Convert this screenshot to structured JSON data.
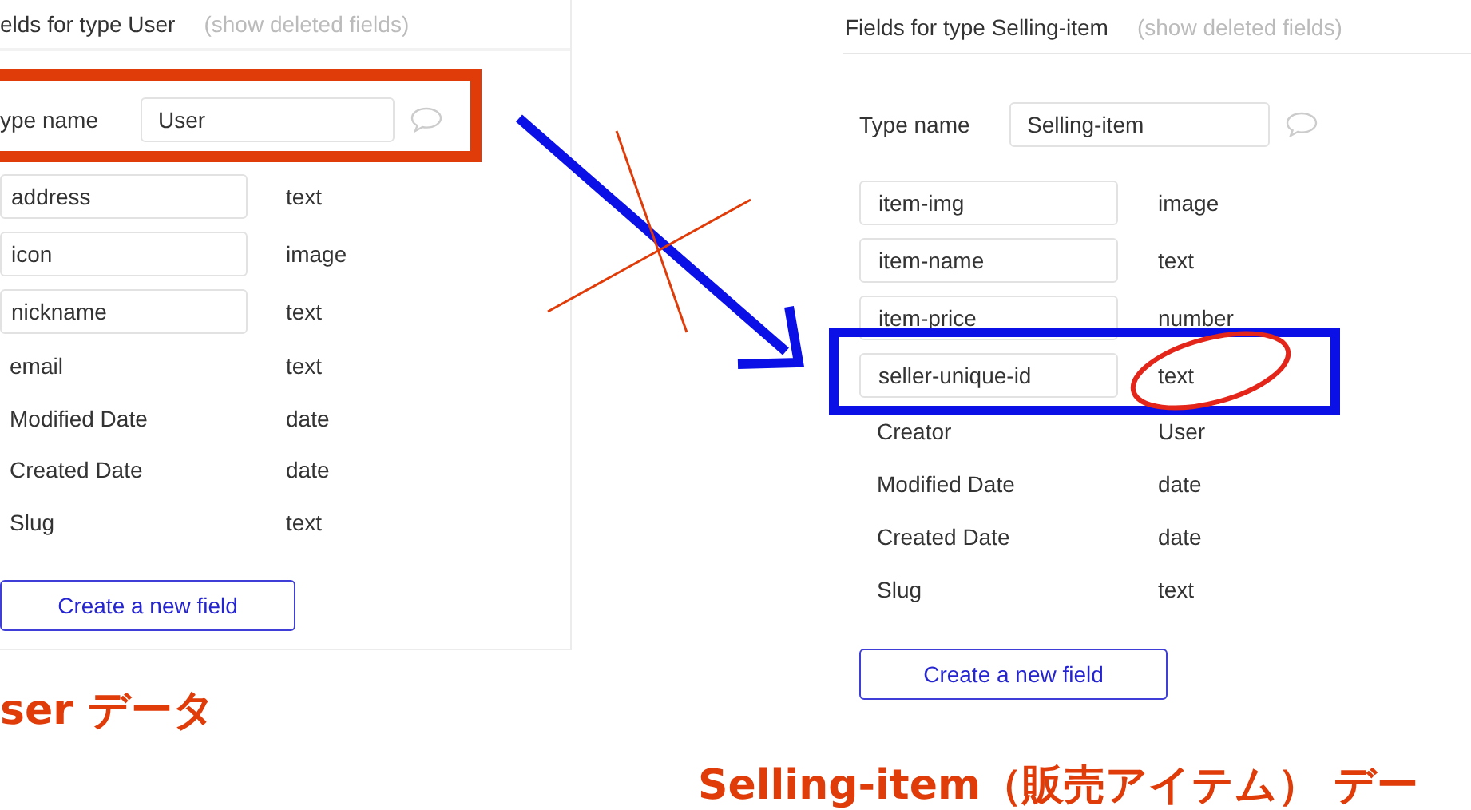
{
  "panels": [
    {
      "title": "elds for type User",
      "show_deleted": "(show deleted fields)",
      "type_name_label": "ype name",
      "type_name_value": "User",
      "fields": [
        {
          "name": "address",
          "type": "text",
          "kind": "editable"
        },
        {
          "name": "icon",
          "type": "image",
          "kind": "editable"
        },
        {
          "name": "nickname",
          "type": "text",
          "kind": "editable"
        },
        {
          "name": "email",
          "type": "text",
          "kind": "builtin"
        },
        {
          "name": "Modified Date",
          "type": "date",
          "kind": "builtin"
        },
        {
          "name": "Created Date",
          "type": "date",
          "kind": "builtin"
        },
        {
          "name": "Slug",
          "type": "text",
          "kind": "builtin"
        }
      ],
      "create_button": "Create a new field"
    },
    {
      "title": "Fields for type Selling-item",
      "show_deleted": "(show deleted fields)",
      "type_name_label": "Type name",
      "type_name_value": "Selling-item",
      "fields": [
        {
          "name": "item-img",
          "type": "image",
          "kind": "editable"
        },
        {
          "name": "item-name",
          "type": "text",
          "kind": "editable"
        },
        {
          "name": "item-price",
          "type": "number",
          "kind": "editable"
        },
        {
          "name": "seller-unique-id",
          "type": "text",
          "kind": "editable"
        },
        {
          "name": "Creator",
          "type": "User",
          "kind": "builtin"
        },
        {
          "name": "Modified Date",
          "type": "date",
          "kind": "builtin"
        },
        {
          "name": "Created Date",
          "type": "date",
          "kind": "builtin"
        },
        {
          "name": "Slug",
          "type": "text",
          "kind": "builtin"
        }
      ],
      "create_button": "Create a new field"
    }
  ],
  "captions": [
    "ser データ",
    "Selling-item（販売アイテム） デー"
  ]
}
